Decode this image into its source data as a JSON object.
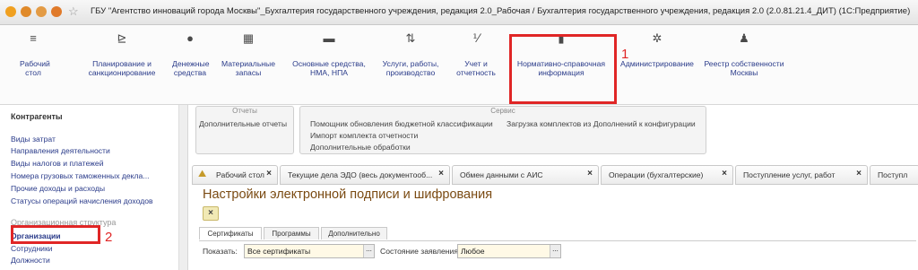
{
  "window": {
    "title": "ГБУ \"Агентство инноваций города Москвы\"_Бухгалтерия государственного учреждения, редакция 2.0_Рабочая / Бухгалтерия государственного учреждения, редакция 2.0 (2.0.81.21.4_ДИТ) (1С:Предприятие)"
  },
  "sections": [
    {
      "label1": "Рабочий",
      "label2": "стол",
      "icon": "menu-lines-icon"
    },
    {
      "label1": "Планирование и",
      "label2": "санкционирование",
      "icon": "planning-icon"
    },
    {
      "label1": "Денежные",
      "label2": "средства",
      "icon": "money-icon"
    },
    {
      "label1": "Материальные",
      "label2": "запасы",
      "icon": "inventory-icon"
    },
    {
      "label1": "Основные средства,",
      "label2": "НМА, НПА",
      "icon": "truck-icon"
    },
    {
      "label1": "Услуги, работы,",
      "label2": "производство",
      "icon": "services-icon"
    },
    {
      "label1": "Учет и",
      "label2": "отчетность",
      "icon": "accounting-icon"
    },
    {
      "label1": "Нормативно-справочная",
      "label2": "информация",
      "icon": "reference-books-icon"
    },
    {
      "label1": "Администрирование",
      "label2": "",
      "icon": "gear-icon"
    },
    {
      "label1": "Реестр собственности",
      "label2": "Москвы",
      "icon": "flag-icon"
    }
  ],
  "annotations": {
    "marker1": "1",
    "marker2": "2"
  },
  "sidebar": {
    "group1_title": "Контрагенты",
    "items": [
      "Виды затрат",
      "Направления деятельности",
      "Виды налогов и платежей",
      "Номера грузовых таможенных декла...",
      "Прочие доходы и расходы",
      "Статусы операций начисления доходов"
    ],
    "group2_title": "Организационная структура",
    "items2": [
      "Организации",
      "Сотрудники",
      "Должности"
    ]
  },
  "reports": {
    "header": "Отчеты",
    "items": [
      "Дополнительные отчеты"
    ]
  },
  "service": {
    "header": "Сервис",
    "items": [
      "Помощник обновления бюджетной классификации",
      "Импорт комплекта отчетности",
      "Дополнительные обработки",
      "Загрузка комплектов из Дополнений к конфигурации"
    ]
  },
  "tabs": [
    {
      "label": "Рабочий стол"
    },
    {
      "label": "Текущие дела ЭДО (весь документооб..."
    },
    {
      "label": "Обмен данными с АИС"
    },
    {
      "label": "Операции (бухгалтерские)"
    },
    {
      "label": "Поступление услуг, работ"
    },
    {
      "label": "Поступл"
    }
  ],
  "form": {
    "title": "Настройки электронной подписи и шифрования",
    "subtabs": [
      "Сертификаты",
      "Программы",
      "Дополнительно"
    ],
    "show_label": "Показать:",
    "show_value": "Все сертификаты",
    "status_label": "Состояние заявления:",
    "status_value": "Любое",
    "dropdown_glyph": "...",
    "close_glyph": "×",
    "tab_close_glyph": "×"
  },
  "colors": {
    "highlight": "#e02626",
    "link": "#2a3b8a",
    "form_title": "#7a4a12"
  }
}
